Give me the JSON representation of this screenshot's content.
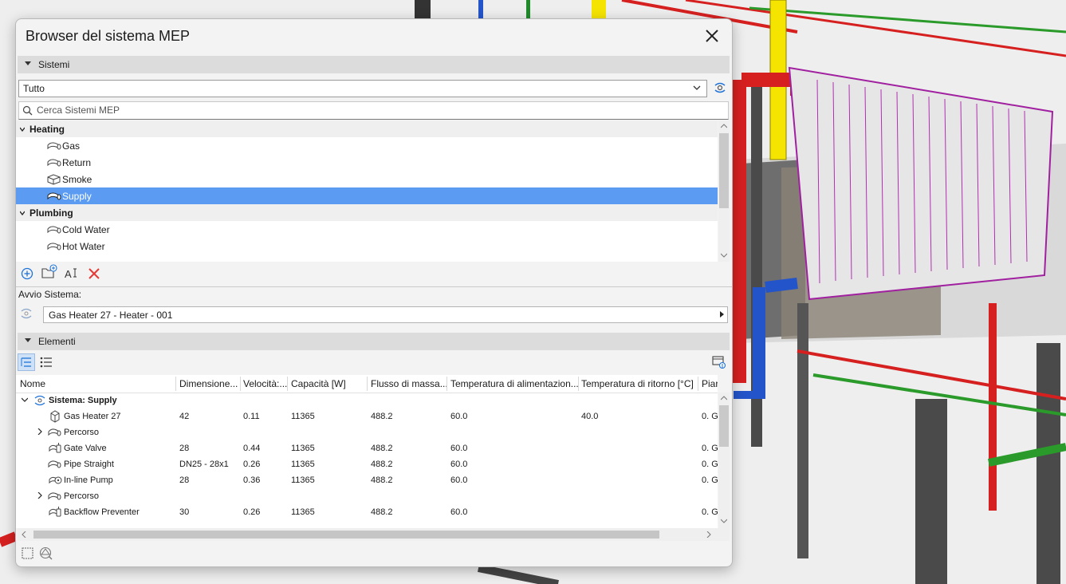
{
  "window": {
    "title": "Browser del sistema MEP",
    "close_icon": "close-icon"
  },
  "sistemi": {
    "header": "Sistemi",
    "filter_value": "Tutto",
    "search_placeholder": "Cerca Sistemi MEP",
    "groups": [
      {
        "label": "Heating",
        "items": [
          {
            "label": "Gas",
            "icon": "pipe-system-icon"
          },
          {
            "label": "Return",
            "icon": "pipe-system-icon"
          },
          {
            "label": "Smoke",
            "icon": "duct-system-icon"
          },
          {
            "label": "Supply",
            "icon": "pipe-system-icon",
            "selected": true
          }
        ]
      },
      {
        "label": "Plumbing",
        "items": [
          {
            "label": "Cold Water",
            "icon": "pipe-system-icon"
          },
          {
            "label": "Hot Water",
            "icon": "pipe-system-icon"
          }
        ]
      }
    ],
    "toolbar": [
      "add-system-icon",
      "new-folder-icon",
      "rename-icon",
      "delete-icon"
    ]
  },
  "avvio": {
    "label": "Avvio Sistema:",
    "value": "Gas Heater 27 - Heater - 001"
  },
  "elementi": {
    "header": "Elementi",
    "columns": [
      "Nome",
      "Dimensione...",
      "Velocità:...",
      "Capacità [W]",
      "Flusso di massa...",
      "Temperatura di alimentazion...",
      "Temperatura di ritorno [°C]",
      "Piar"
    ],
    "rows": [
      {
        "name": "Sistema: Supply",
        "level": 0,
        "expanded": true,
        "bold": true,
        "icon": "system-icon",
        "cells": [
          "",
          "",
          "",
          "",
          "",
          "",
          ""
        ]
      },
      {
        "name": "Gas Heater 27",
        "level": 1,
        "icon": "heater-icon",
        "cells": [
          "42",
          "0.11",
          "11365",
          "488.2",
          "60.0",
          "40.0",
          "0. G"
        ]
      },
      {
        "name": "Percorso",
        "level": 1,
        "collapsed": true,
        "icon": "route-icon",
        "cells": [
          "",
          "",
          "",
          "",
          "",
          "",
          ""
        ]
      },
      {
        "name": "Gate Valve",
        "level": 1,
        "icon": "valve-icon",
        "cells": [
          "28",
          "0.44",
          "11365",
          "488.2",
          "60.0",
          "",
          "0. G"
        ]
      },
      {
        "name": "Pipe Straight",
        "level": 1,
        "icon": "pipe-icon",
        "cells": [
          "DN25 - 28x1",
          "0.26",
          "11365",
          "488.2",
          "60.0",
          "",
          "0. G"
        ]
      },
      {
        "name": "In-line Pump",
        "level": 1,
        "icon": "pump-icon",
        "cells": [
          "28",
          "0.36",
          "11365",
          "488.2",
          "60.0",
          "",
          "0. G"
        ]
      },
      {
        "name": "Percorso",
        "level": 1,
        "collapsed": true,
        "icon": "route-icon",
        "cells": [
          "",
          "",
          "",
          "",
          "",
          "",
          ""
        ]
      },
      {
        "name": "Backflow Preventer",
        "level": 1,
        "icon": "valve-icon",
        "cells": [
          "30",
          "0.26",
          "11365",
          "488.2",
          "60.0",
          "",
          "0. G"
        ]
      }
    ]
  },
  "colors": {
    "selection": "#5b9cf2",
    "delete": "#e53935",
    "accent_blue": "#1e73d8"
  }
}
